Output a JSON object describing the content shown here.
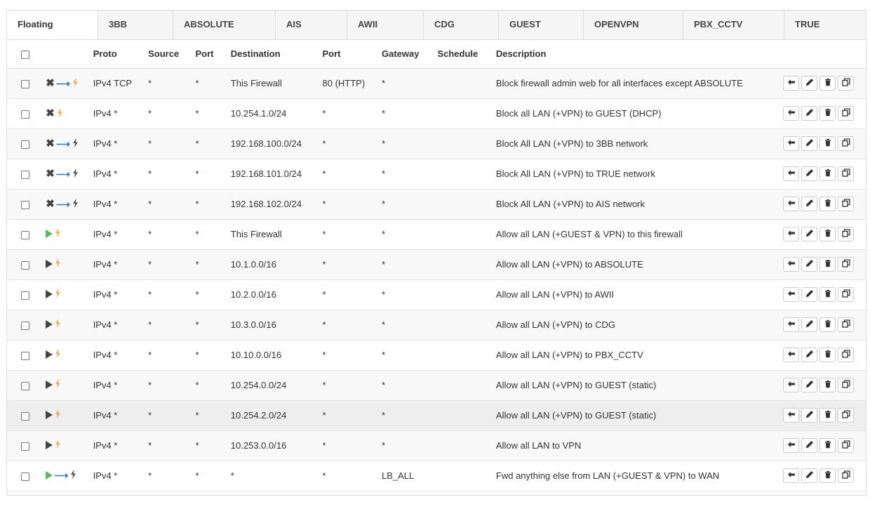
{
  "tabs": [
    {
      "label": "Floating",
      "active": true
    },
    {
      "label": "3BB"
    },
    {
      "label": "ABSOLUTE"
    },
    {
      "label": "AIS"
    },
    {
      "label": "AWII"
    },
    {
      "label": "CDG"
    },
    {
      "label": "GUEST"
    },
    {
      "label": "OPENVPN"
    },
    {
      "label": "PBX_CCTV"
    },
    {
      "label": "TRUE"
    }
  ],
  "table": {
    "headers": {
      "proto": "Proto",
      "source": "Source",
      "port": "Port",
      "destination": "Destination",
      "dport": "Port",
      "gateway": "Gateway",
      "schedule": "Schedule",
      "description": "Description"
    },
    "rows": [
      {
        "action": "block",
        "direction": "out",
        "bolt_color": "#f0ad4e",
        "proto": "IPv4 TCP",
        "source": "*",
        "port": "*",
        "destination": "This Firewall",
        "dport": "80 (HTTP)",
        "gateway": "*",
        "schedule": "",
        "description": "Block firewall admin web for all interfaces except ABSOLUTE"
      },
      {
        "action": "block",
        "direction": "any",
        "bolt_color": "#f0ad4e",
        "proto": "IPv4 *",
        "source": "*",
        "port": "*",
        "destination": "10.254.1.0/24",
        "dport": "*",
        "gateway": "*",
        "schedule": "",
        "description": "Block all LAN (+VPN) to GUEST (DHCP)"
      },
      {
        "action": "block",
        "direction": "out",
        "bolt_color": "#555555",
        "proto": "IPv4 *",
        "source": "*",
        "port": "*",
        "destination": "192.168.100.0/24",
        "dport": "*",
        "gateway": "*",
        "schedule": "",
        "description": "Block All LAN (+VPN) to 3BB network"
      },
      {
        "action": "block",
        "direction": "out",
        "bolt_color": "#555555",
        "proto": "IPv4 *",
        "source": "*",
        "port": "*",
        "destination": "192.168.101.0/24",
        "dport": "*",
        "gateway": "*",
        "schedule": "",
        "description": "Block All LAN (+VPN) to TRUE network"
      },
      {
        "action": "block",
        "direction": "out",
        "bolt_color": "#555555",
        "proto": "IPv4 *",
        "source": "*",
        "port": "*",
        "destination": "192.168.102.0/24",
        "dport": "*",
        "gateway": "*",
        "schedule": "",
        "description": "Block All LAN (+VPN) to AIS network"
      },
      {
        "action": "pass-green",
        "direction": "any",
        "bolt_color": "#f0ad4e",
        "proto": "IPv4 *",
        "source": "*",
        "port": "*",
        "destination": "This Firewall",
        "dport": "*",
        "gateway": "*",
        "schedule": "",
        "description": "Allow all LAN (+GUEST & VPN) to this firewall"
      },
      {
        "action": "pass",
        "direction": "any",
        "bolt_color": "#f0ad4e",
        "proto": "IPv4 *",
        "source": "*",
        "port": "*",
        "destination": "10.1.0.0/16",
        "dport": "*",
        "gateway": "*",
        "schedule": "",
        "description": "Allow all LAN (+VPN) to ABSOLUTE"
      },
      {
        "action": "pass",
        "direction": "any",
        "bolt_color": "#f0ad4e",
        "proto": "IPv4 *",
        "source": "*",
        "port": "*",
        "destination": "10.2.0.0/16",
        "dport": "*",
        "gateway": "*",
        "schedule": "",
        "description": "Allow all LAN (+VPN) to AWII"
      },
      {
        "action": "pass",
        "direction": "any",
        "bolt_color": "#f0ad4e",
        "proto": "IPv4 *",
        "source": "*",
        "port": "*",
        "destination": "10.3.0.0/16",
        "dport": "*",
        "gateway": "*",
        "schedule": "",
        "description": "Allow all LAN (+VPN) to CDG"
      },
      {
        "action": "pass",
        "direction": "any",
        "bolt_color": "#f0ad4e",
        "proto": "IPv4 *",
        "source": "*",
        "port": "*",
        "destination": "10.10.0.0/16",
        "dport": "*",
        "gateway": "*",
        "schedule": "",
        "description": "Allow all LAN (+VPN) to PBX_CCTV"
      },
      {
        "action": "pass",
        "direction": "any",
        "bolt_color": "#f0ad4e",
        "proto": "IPv4 *",
        "source": "*",
        "port": "*",
        "destination": "10.254.0.0/24",
        "dport": "*",
        "gateway": "*",
        "schedule": "",
        "description": "Allow all LAN (+VPN) to GUEST (static)"
      },
      {
        "action": "pass",
        "direction": "any",
        "bolt_color": "#f0ad4e",
        "proto": "IPv4 *",
        "source": "*",
        "port": "*",
        "destination": "10.254.2.0/24",
        "dport": "*",
        "gateway": "*",
        "schedule": "",
        "description": "Allow all LAN (+VPN) to GUEST (static)"
      },
      {
        "action": "pass",
        "direction": "any",
        "bolt_color": "#f0ad4e",
        "proto": "IPv4 *",
        "source": "*",
        "port": "*",
        "destination": "10.253.0.0/16",
        "dport": "*",
        "gateway": "*",
        "schedule": "",
        "description": "Allow all LAN to VPN"
      },
      {
        "action": "pass-green",
        "direction": "out",
        "bolt_color": "#555555",
        "proto": "IPv4 *",
        "source": "*",
        "port": "*",
        "destination": "*",
        "dport": "*",
        "gateway": "LB_ALL",
        "schedule": "",
        "description": "Fwd anything else from LAN (+GUEST & VPN) to WAN"
      }
    ],
    "row_actions": [
      "move-icon",
      "edit-icon",
      "delete-icon",
      "copy-icon"
    ]
  }
}
